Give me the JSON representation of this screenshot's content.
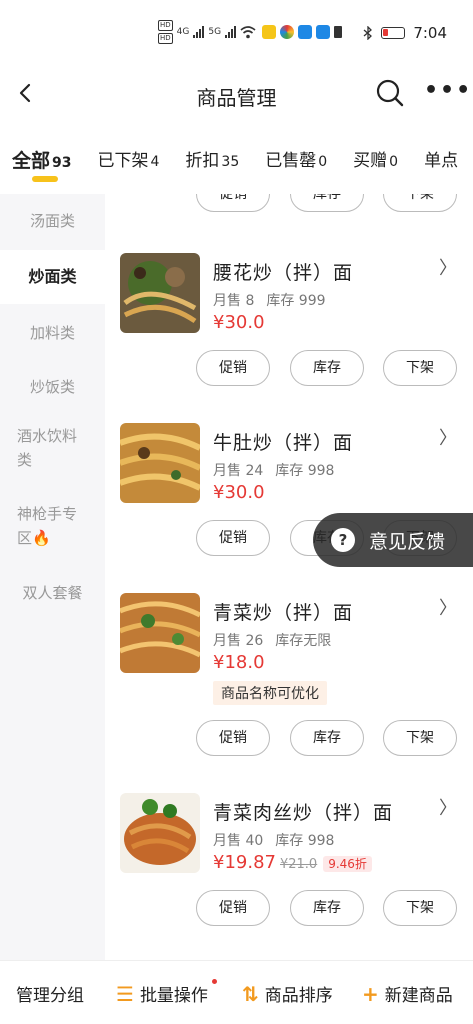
{
  "status_bar": {
    "time": "7:04",
    "network_labels": [
      "HD",
      "4G",
      "HD",
      "5G"
    ],
    "icons": [
      "signal-icon",
      "wifi-icon",
      "app-icon",
      "app-icon",
      "app-icon",
      "sim-icon",
      "bluetooth-icon",
      "battery-icon"
    ]
  },
  "nav": {
    "title": "商品管理",
    "back_icon": "chevron-left-icon",
    "search_icon": "search-icon",
    "more_icon": "more-icon",
    "more_text": "•••"
  },
  "tabs": [
    {
      "label": "全部",
      "count": "93"
    },
    {
      "label": "已下架",
      "count": "4"
    },
    {
      "label": "折扣",
      "count": "35"
    },
    {
      "label": "已售罄",
      "count": "0"
    },
    {
      "label": "买赠",
      "count": "0"
    },
    {
      "label": "单点",
      "count": ""
    }
  ],
  "sidebar": {
    "items": [
      {
        "label": "汤面类"
      },
      {
        "label": "炒面类"
      },
      {
        "label": "加料类"
      },
      {
        "label": "炒饭类"
      },
      {
        "label": "酒水饮料类"
      },
      {
        "label": "神枪手专区🔥"
      },
      {
        "label": "双人套餐"
      }
    ]
  },
  "actions": {
    "promote": "促销",
    "stock": "库存",
    "delist": "下架"
  },
  "products": [
    {
      "name": "腰花炒（拌）面",
      "monthly_sales": "月售 8",
      "stock": "库存 999",
      "price": "¥30.0"
    },
    {
      "name": "牛肚炒（拌）面",
      "monthly_sales": "月售 24",
      "stock": "库存 998",
      "price": "¥30.0"
    },
    {
      "name": "青菜炒（拌）面",
      "monthly_sales": "月售 26",
      "stock": "库存无限",
      "price": "¥18.0",
      "hint": "商品名称可优化"
    },
    {
      "name": "青菜肉丝炒（拌）面",
      "monthly_sales": "月售 40",
      "stock": "库存 998",
      "price": "¥19.87",
      "original_price": "¥21.0",
      "discount": "9.46折"
    }
  ],
  "feedback": {
    "label": "意见反馈",
    "icon": "question-icon",
    "icon_text": "?"
  },
  "bottom_bar": {
    "manage_groups": "管理分组",
    "batch": "批量操作",
    "sort": "商品排序",
    "new_product": "新建商品",
    "icons": {
      "batch": "☰",
      "sort": "⇅",
      "new": "+"
    }
  }
}
